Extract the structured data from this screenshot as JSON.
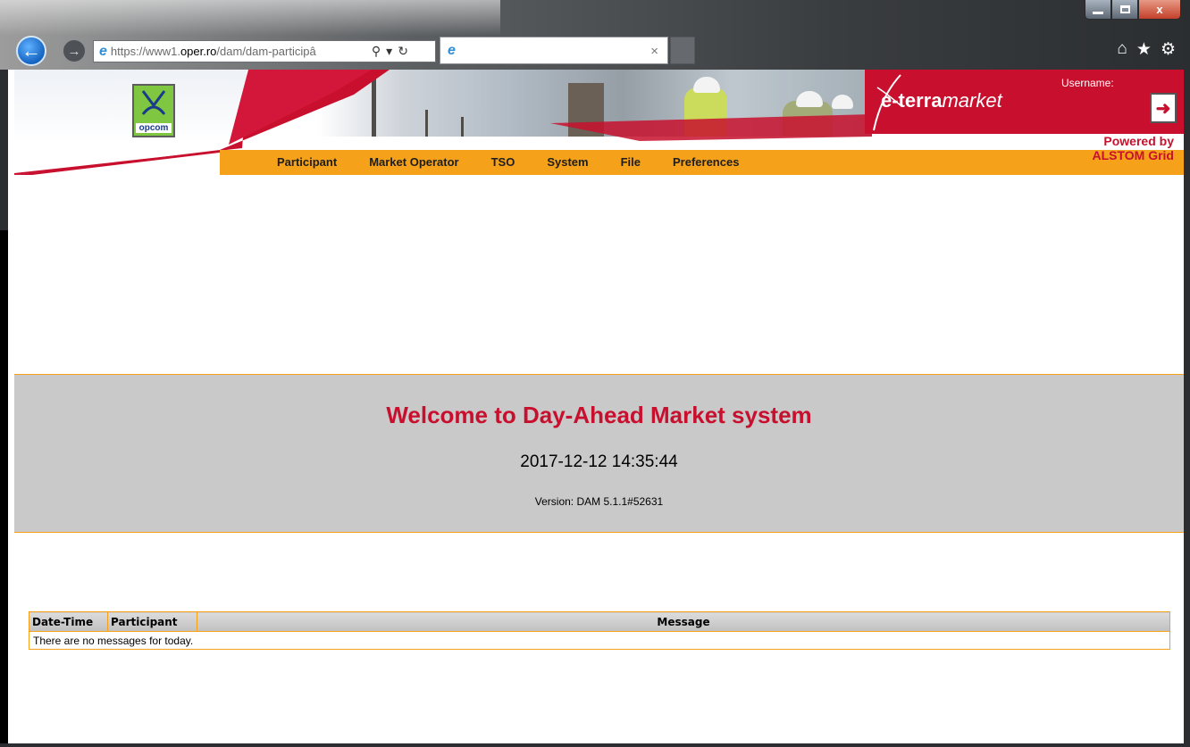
{
  "browser": {
    "address_host_prefix": "https://www1.",
    "address_host_bold": "oper.ro",
    "address_path": "/dam/dam-participâ",
    "tab_title": "",
    "tab_close": "×",
    "icons": [
      "back-arrow-icon",
      "forward-arrow-icon",
      "ie-icon",
      "search-icon",
      "refresh-icon",
      "home-icon",
      "favorites-star-icon",
      "settings-gear-icon"
    ]
  },
  "window": {
    "minimize": "",
    "maximize": "",
    "close": "x"
  },
  "header": {
    "logo_text": "opcom",
    "brand_bold": "e-terra",
    "brand_italic": "market",
    "username_label": "Username:",
    "powered_line1": "Powered by",
    "powered_line2": "ALSTOM Grid",
    "colors": {
      "brand_red": "#c8102e",
      "menu_orange": "#f5a11a"
    }
  },
  "menu": {
    "items": [
      {
        "label": "Participant"
      },
      {
        "label": "Market Operator"
      },
      {
        "label": "TSO"
      },
      {
        "label": "System"
      },
      {
        "label": "File"
      },
      {
        "label": "Preferences"
      }
    ]
  },
  "welcome": {
    "title": "Welcome to Day-Ahead Market system",
    "datetime": "2017-12-12 14:35:44",
    "version": "Version: DAM 5.1.1#52631"
  },
  "messages": {
    "columns": [
      "Date-Time",
      "Participant",
      "Message"
    ],
    "empty_text": "There are no messages for today."
  }
}
